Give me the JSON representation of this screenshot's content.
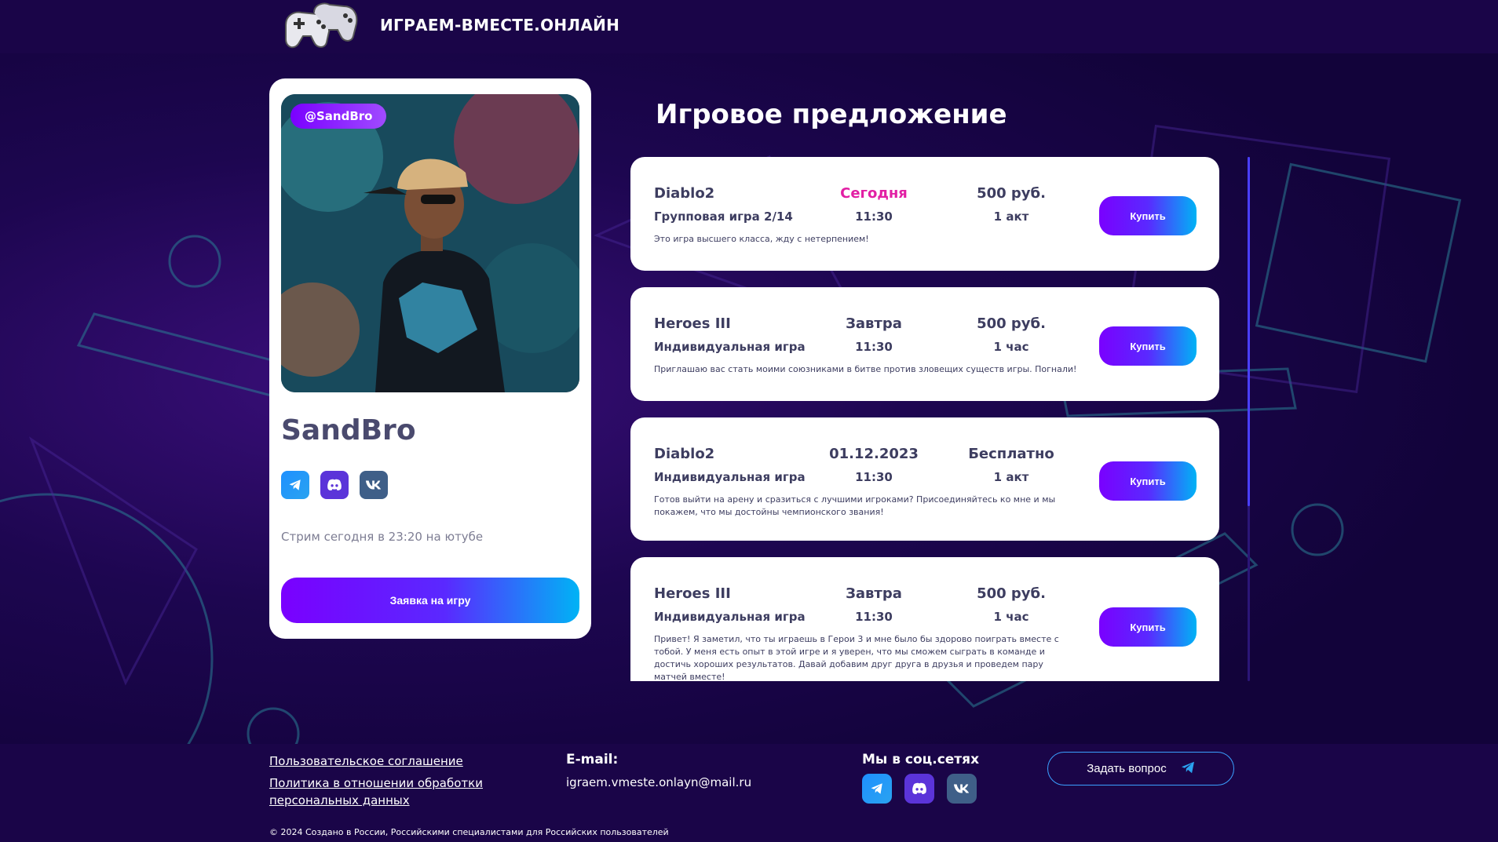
{
  "header": {
    "site_title": "ИГРАЕМ-ВМЕСТЕ.ОНЛАЙН"
  },
  "profile": {
    "handle": "@SandBro",
    "name": "SandBro",
    "stream_note": "Стрим сегодня в 23:20 на ютубе",
    "apply_label": "Заявка на игру",
    "socials": [
      "telegram-icon",
      "discord-icon",
      "vk-icon"
    ]
  },
  "offers_section": {
    "title": "Игровое предложение",
    "items": [
      {
        "game": "Diablo2",
        "type": "Групповая игра 2/14",
        "day": "Сегодня",
        "time": "11:30",
        "price": "500 руб.",
        "duration": "1 акт",
        "description": "Это игра высшего класса, жду с нетерпением!",
        "buy_label": "Купить"
      },
      {
        "game": "Heroes III",
        "type": "Индивидуальная игра",
        "day": "Завтра",
        "time": "11:30",
        "price": "500 руб.",
        "duration": "1 час",
        "description": "Приглашаю вас стать моими союзниками в битве против зловещих существ игры. Погнали!",
        "buy_label": "Купить"
      },
      {
        "game": "Diablo2",
        "type": "Индивидуальная игра",
        "day": "01.12.2023",
        "time": "11:30",
        "price": "Бесплатно",
        "duration": "1 акт",
        "description": "Готов выйти на арену и сразиться с лучшими игроками? Присоединяйтесь ко мне и мы покажем, что мы достойны чемпионского звания!",
        "buy_label": "Купить"
      },
      {
        "game": "Heroes III",
        "type": "Индивидуальная игра",
        "day": "Завтра",
        "time": "11:30",
        "price": "500 руб.",
        "duration": "1 час",
        "description": "Привет! Я заметил, что ты играешь в Герои 3 и мне было бы здорово поиграть вместе с тобой. У меня есть опыт в этой игре и я уверен, что мы сможем сыграть в команде и достичь хороших результатов. Давай добавим друг друга в друзья и проведем пару матчей вместе!",
        "buy_label": "Купить"
      }
    ]
  },
  "footer": {
    "user_agreement": "Пользовательское соглашение",
    "privacy_policy_line1": "Политика в отношении обработки",
    "privacy_policy_line2": "персональных данных",
    "email_title": "E-mail:",
    "email": "igraem.vmeste.onlayn@mail.ru",
    "social_title": "Мы в соц.сетях",
    "ask_label": "Задать вопрос",
    "copyright": "© 2024 Создано в России, Российскими специалистами для Российских пользователей"
  },
  "colors": {
    "accent_purple": "#7a00ff",
    "accent_cyan": "#00b3f5",
    "today_pink": "#e21fa4",
    "page_bg": "#12033a"
  }
}
